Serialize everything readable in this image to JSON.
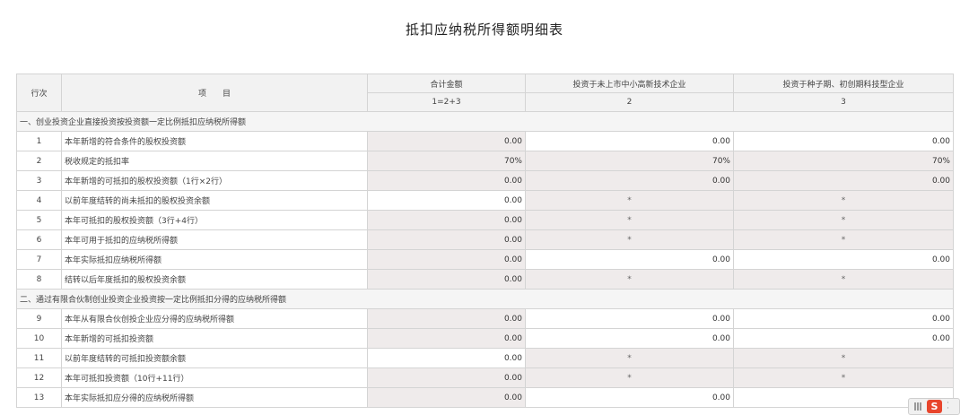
{
  "title": "抵扣应纳税所得额明细表",
  "header": {
    "row_no": "行次",
    "item": "项　　目",
    "columns": [
      {
        "label": "合计金额",
        "formula": "1=2+3"
      },
      {
        "label": "投资于未上市中小高新技术企业",
        "formula": "2"
      },
      {
        "label": "投资于种子期、初创期科技型企业",
        "formula": "3"
      }
    ]
  },
  "sections": [
    {
      "label": "一、创业投资企业直接投资按投资额一定比例抵扣应纳税所得额",
      "rows": [
        {
          "no": "1",
          "item": "本年新增的符合条件的股权投资额",
          "c1": "0.00",
          "c2": "0.00",
          "c3": "0.00"
        },
        {
          "no": "2",
          "item": "税收规定的抵扣率",
          "c1": "70%",
          "c2": "70%",
          "c3": "70%"
        },
        {
          "no": "3",
          "item": "本年新增的可抵扣的股权投资额（1行×2行）",
          "c1": "0.00",
          "c2": "0.00",
          "c3": "0.00"
        },
        {
          "no": "4",
          "item": "以前年度结转的尚未抵扣的股权投资余额",
          "c1": "0.00",
          "c2": "*",
          "c3": "*"
        },
        {
          "no": "5",
          "item": "本年可抵扣的股权投资额（3行+4行）",
          "c1": "0.00",
          "c2": "*",
          "c3": "*"
        },
        {
          "no": "6",
          "item": "本年可用于抵扣的应纳税所得额",
          "c1": "0.00",
          "c2": "*",
          "c3": "*"
        },
        {
          "no": "7",
          "item": "本年实际抵扣应纳税所得额",
          "c1": "0.00",
          "c2": "0.00",
          "c3": "0.00"
        },
        {
          "no": "8",
          "item": "结转以后年度抵扣的股权投资余额",
          "c1": "0.00",
          "c2": "*",
          "c3": "*"
        }
      ]
    },
    {
      "label": "二、通过有限合伙制创业投资企业投资按一定比例抵扣分得的应纳税所得额",
      "rows": [
        {
          "no": "9",
          "item": "本年从有限合伙创投企业应分得的应纳税所得额",
          "c1": "0.00",
          "c2": "0.00",
          "c3": "0.00"
        },
        {
          "no": "10",
          "item": "本年新增的可抵扣投资额",
          "c1": "0.00",
          "c2": "0.00",
          "c3": "0.00"
        },
        {
          "no": "11",
          "item": "以前年度结转的可抵扣投资额余额",
          "c1": "0.00",
          "c2": "*",
          "c3": "*"
        },
        {
          "no": "12",
          "item": "本年可抵扣投资额（10行+11行）",
          "c1": "0.00",
          "c2": "*",
          "c3": "*"
        },
        {
          "no": "13",
          "item": "本年实际抵扣应分得的应纳税所得额",
          "c1": "0.00",
          "c2": "0.00",
          "c3": ""
        }
      ]
    }
  ],
  "ime": {
    "logo": "S"
  }
}
